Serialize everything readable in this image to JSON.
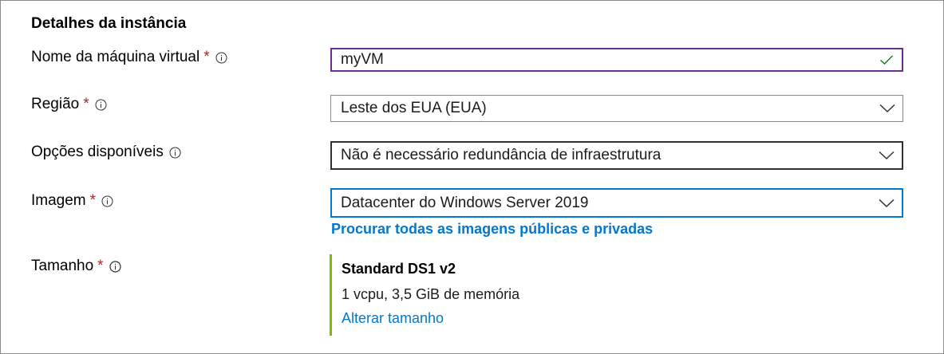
{
  "section": {
    "title": "Detalhes da instância"
  },
  "rows": {
    "vm_name": {
      "label": "Nome da máquina virtual",
      "required": "*",
      "value": "myVM"
    },
    "region": {
      "label": "Região",
      "required": "*",
      "value": "Leste dos EUA (EUA)"
    },
    "availability": {
      "label": "Opções disponíveis",
      "value": "Não é necessário redundância de infraestrutura"
    },
    "image": {
      "label": "Imagem",
      "required": "*",
      "value": "Datacenter do Windows Server 2019",
      "browse_link": "Procurar todas as imagens públicas e privadas"
    },
    "size": {
      "label": "Tamanho",
      "required": "*",
      "name": "Standard DS1 v2",
      "description": "1 vcpu, 3,5 GiB de memória",
      "change_link": "Alterar tamanho"
    }
  },
  "icons": {
    "info": "info-icon",
    "valid": "check-icon",
    "dropdown": "chevron-down-icon"
  },
  "colors": {
    "required": "#a4262c",
    "valid_check": "#107c10",
    "focus_border": "#0078d4",
    "text_border": "#6b2e8f",
    "link": "#0078d4",
    "size_accent": "#7fba00"
  }
}
